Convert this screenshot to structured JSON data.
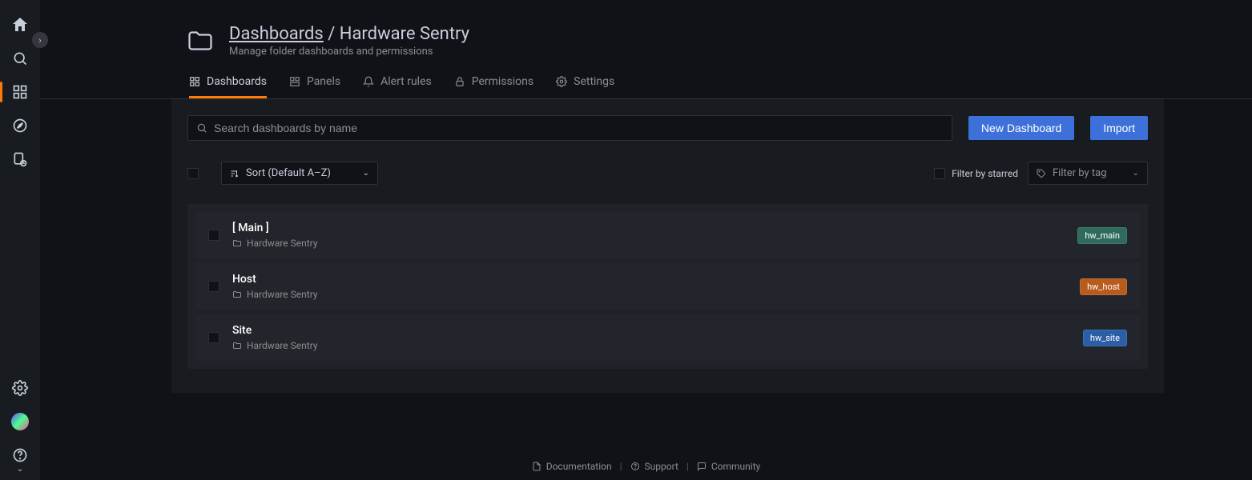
{
  "header": {
    "breadcrumb_root": "Dashboards",
    "breadcrumb_sep": " / ",
    "breadcrumb_leaf": "Hardware Sentry",
    "subtitle": "Manage folder dashboards and permissions"
  },
  "tabs": [
    {
      "label": "Dashboards",
      "icon": "grid-icon",
      "active": true
    },
    {
      "label": "Panels",
      "icon": "panel-icon",
      "active": false
    },
    {
      "label": "Alert rules",
      "icon": "bell-icon",
      "active": false
    },
    {
      "label": "Permissions",
      "icon": "lock-icon",
      "active": false
    },
    {
      "label": "Settings",
      "icon": "gear-icon",
      "active": false
    }
  ],
  "search": {
    "placeholder": "Search dashboards by name"
  },
  "buttons": {
    "new_dashboard": "New Dashboard",
    "import": "Import"
  },
  "sort": {
    "label": "Sort (Default A–Z)"
  },
  "filters": {
    "starred_label": "Filter by starred",
    "tag_label": "Filter by tag"
  },
  "items": [
    {
      "title": "[ Main ]",
      "folder": "Hardware Sentry",
      "tag": "hw_main",
      "tag_color": "#2f6b5c"
    },
    {
      "title": "Host",
      "folder": "Hardware Sentry",
      "tag": "hw_host",
      "tag_color": "#b85c1e"
    },
    {
      "title": "Site",
      "folder": "Hardware Sentry",
      "tag": "hw_site",
      "tag_color": "#2c5ea8"
    }
  ],
  "footer": {
    "documentation": "Documentation",
    "support": "Support",
    "community": "Community"
  }
}
